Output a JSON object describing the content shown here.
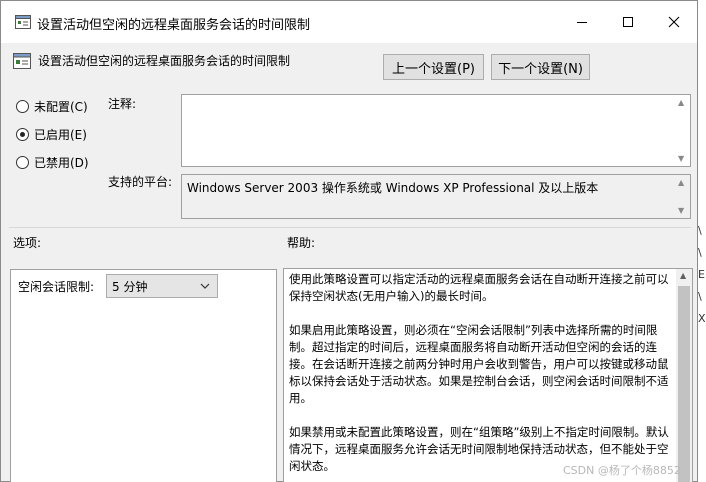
{
  "window": {
    "title": "设置活动但空闲的远程桌面服务会话的时间限制",
    "header_title": "设置活动但空闲的远程桌面服务会话的时间限制"
  },
  "nav": {
    "prev_label": "上一个设置(P)",
    "next_label": "下一个设置(N)"
  },
  "state": {
    "options": [
      {
        "label": "未配置(C)",
        "checked": false
      },
      {
        "label": "已启用(E)",
        "checked": true
      },
      {
        "label": "已禁用(D)",
        "checked": false
      }
    ]
  },
  "comment": {
    "label": "注释:",
    "value": ""
  },
  "platform": {
    "label": "支持的平台:",
    "value": "Windows Server 2003 操作系统或 Windows XP Professional 及以上版本"
  },
  "options_section": {
    "label": "选项:",
    "idle_limit_label": "空闲会话限制:",
    "idle_limit_value": "5 分钟"
  },
  "help_section": {
    "label": "帮助:",
    "paragraphs": [
      "使用此策略设置可以指定活动的远程桌面服务会话在自动断开连接之前可以保持空闲状态(无用户输入)的最长时间。",
      "如果启用此策略设置，则必须在“空闲会话限制”列表中选择所需的时间限制。超过指定的时间后，远程桌面服务将自动断开活动但空闲的会话的连接。在会话断开连接之前两分钟时用户会收到警告，用户可以按键或移动鼠标以保持会话处于活动状态。如果是控制台会话，则空闲会话时间限制不适用。",
      "如果禁用或未配置此策略设置，则在“组策略”级别上不指定时间限制。默认情况下，远程桌面服务允许会话无时间限制地保持活动状态，但不能处于空闲状态。"
    ]
  },
  "watermark": "CSDN @杨了个杨8852",
  "background_fragments": [
    "\\",
    "\\",
    "E",
    "\\",
    "X"
  ]
}
